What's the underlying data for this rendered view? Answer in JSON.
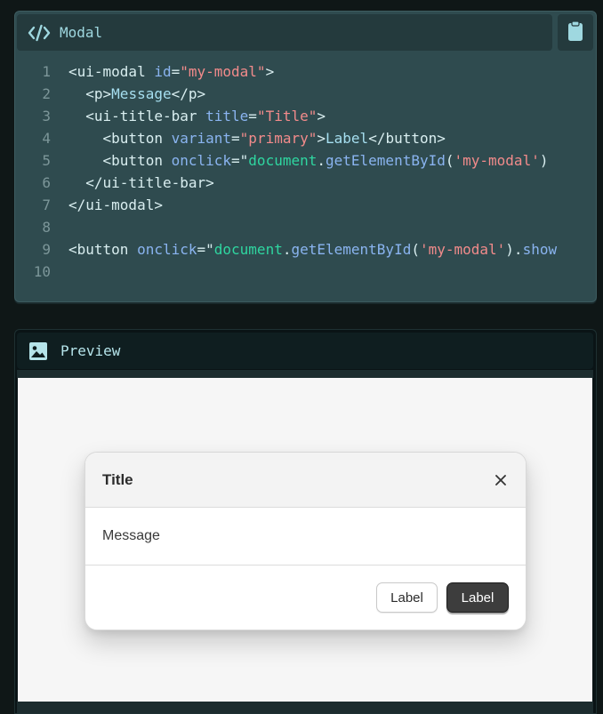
{
  "code_panel": {
    "title": "Modal",
    "title_icon": "code-icon",
    "copy_icon": "clipboard-icon",
    "lines": [
      {
        "n": "1",
        "tokens": [
          [
            "tag",
            "<ui-modal "
          ],
          [
            "attr",
            "id"
          ],
          [
            "punc",
            "="
          ],
          [
            "str",
            "\"my-modal\""
          ],
          [
            "tag",
            ">"
          ]
        ]
      },
      {
        "n": "2",
        "tokens": [
          [
            "tag",
            "  <p>"
          ],
          [
            "txt",
            "Message"
          ],
          [
            "tag",
            "</p>"
          ]
        ]
      },
      {
        "n": "3",
        "tokens": [
          [
            "tag",
            "  <ui-title-bar "
          ],
          [
            "attr",
            "title"
          ],
          [
            "punc",
            "="
          ],
          [
            "str",
            "\"Title\""
          ],
          [
            "tag",
            ">"
          ]
        ]
      },
      {
        "n": "4",
        "tokens": [
          [
            "tag",
            "    <button "
          ],
          [
            "attr",
            "variant"
          ],
          [
            "punc",
            "="
          ],
          [
            "str",
            "\"primary\""
          ],
          [
            "tag",
            ">"
          ],
          [
            "txt",
            "Label"
          ],
          [
            "tag",
            "</button>"
          ]
        ]
      },
      {
        "n": "5",
        "tokens": [
          [
            "tag",
            "    <button "
          ],
          [
            "attr",
            "onclick"
          ],
          [
            "punc",
            "=\""
          ],
          [
            "js",
            "document"
          ],
          [
            "punc",
            "."
          ],
          [
            "fn",
            "getElementById"
          ],
          [
            "punc",
            "("
          ],
          [
            "str",
            "'my-modal'"
          ],
          [
            "punc",
            ")"
          ]
        ]
      },
      {
        "n": "6",
        "tokens": [
          [
            "tag",
            "  </ui-title-bar>"
          ]
        ]
      },
      {
        "n": "7",
        "tokens": [
          [
            "tag",
            "</ui-modal>"
          ]
        ]
      },
      {
        "n": "8",
        "tokens": []
      },
      {
        "n": "9",
        "tokens": [
          [
            "tag",
            "<button "
          ],
          [
            "attr",
            "onclick"
          ],
          [
            "punc",
            "=\""
          ],
          [
            "js",
            "document"
          ],
          [
            "punc",
            "."
          ],
          [
            "fn",
            "getElementById"
          ],
          [
            "punc",
            "("
          ],
          [
            "str",
            "'my-modal'"
          ],
          [
            "punc",
            ")."
          ],
          [
            "fn",
            "show"
          ]
        ]
      },
      {
        "n": "10",
        "tokens": []
      }
    ]
  },
  "preview_panel": {
    "title": "Preview",
    "title_icon": "image-icon"
  },
  "modal": {
    "title": "Title",
    "message": "Message",
    "close_icon": "close-icon",
    "secondary_label": "Label",
    "primary_label": "Label"
  }
}
